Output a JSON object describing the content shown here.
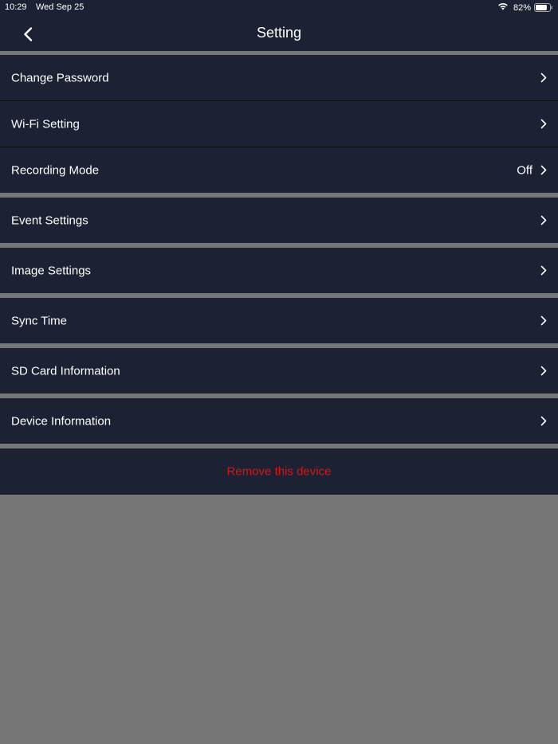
{
  "status_bar": {
    "time": "10:29",
    "date": "Wed Sep 25",
    "battery_percent": "82%",
    "battery_level": 0.82,
    "wifi_icon": "wifi-icon",
    "battery_icon": "battery-icon"
  },
  "nav": {
    "title": "Setting",
    "back_icon": "chevron-left-icon"
  },
  "settings": {
    "change_password": "Change Password",
    "wifi_setting": "Wi-Fi Setting",
    "recording_mode": "Recording Mode",
    "recording_mode_value": "Off",
    "event_settings": "Event Settings",
    "image_settings": "Image Settings",
    "sync_time": "Sync Time",
    "sd_card_information": "SD Card Information",
    "device_information": "Device Information",
    "chevron_icon": "chevron-right-icon"
  },
  "remove_device": {
    "label": "Remove this device"
  },
  "colors": {
    "background_gray": "#767676",
    "row_background": "#1c2233",
    "destructive_red": "#e0110f",
    "text_white": "#ffffff"
  }
}
